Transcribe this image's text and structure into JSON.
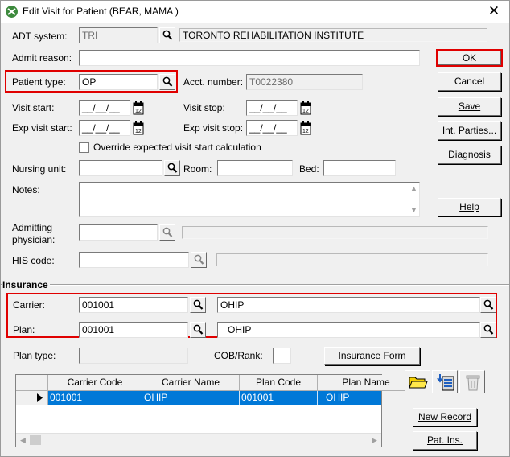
{
  "window": {
    "title": "Edit Visit for Patient (BEAR, MAMA )"
  },
  "form": {
    "adt_system": {
      "label": "ADT system:",
      "value": "TRI",
      "description": "TORONTO REHABILITATION INSTITUTE"
    },
    "admit_reason": {
      "label": "Admit reason:",
      "value": ""
    },
    "patient_type": {
      "label": "Patient type:",
      "value": "OP"
    },
    "acct_number": {
      "label": "Acct. number:",
      "value": "T0022380"
    },
    "visit_start": {
      "label": "Visit start:",
      "value": "__/__/__"
    },
    "visit_stop": {
      "label": "Visit stop:",
      "value": "__/__/__"
    },
    "exp_visit_start": {
      "label": "Exp visit start:",
      "value": "__/__/__"
    },
    "exp_visit_stop": {
      "label": "Exp visit stop:",
      "value": "__/__/__"
    },
    "override": {
      "label": "Override expected visit start calculation",
      "checked": false
    },
    "nursing_unit": {
      "label": "Nursing unit:",
      "value": ""
    },
    "room": {
      "label": "Room:",
      "value": ""
    },
    "bed": {
      "label": "Bed:",
      "value": ""
    },
    "notes": {
      "label": "Notes:",
      "value": ""
    },
    "admitting_physician": {
      "label_line1": "Admitting",
      "label_line2": "physician:",
      "value": ""
    },
    "his_code": {
      "label": "HIS code:",
      "value": ""
    }
  },
  "buttons": {
    "ok": "OK",
    "cancel": "Cancel",
    "save": "Save",
    "int_parties": "Int. Parties...",
    "diagnosis": "Diagnosis",
    "help": "Help",
    "insurance_form": "Insurance Form",
    "new_record": "New Record",
    "pat_ins": "Pat. Ins."
  },
  "insurance": {
    "section_label": "Insurance",
    "carrier": {
      "label": "Carrier:",
      "code": "001001",
      "name": "OHIP"
    },
    "plan": {
      "label": "Plan:",
      "code": "001001",
      "name": "OHIP"
    },
    "plan_type": {
      "label": "Plan type:",
      "value": ""
    },
    "cob_rank": {
      "label": "COB/Rank:",
      "value": ""
    },
    "table": {
      "columns": [
        "Carrier Code",
        "Carrier Name",
        "Plan Code",
        "Plan Name"
      ],
      "rows": [
        [
          "001001",
          "OHIP",
          "001001",
          "OHIP"
        ]
      ]
    }
  },
  "icons": {
    "lookup": "magnifier-icon",
    "calendar": "calendar-icon",
    "open_folder": "folder-icon",
    "import": "import-icon",
    "delete": "delete-icon"
  },
  "colors": {
    "highlight": "#e00000",
    "selection": "#0078d7"
  }
}
